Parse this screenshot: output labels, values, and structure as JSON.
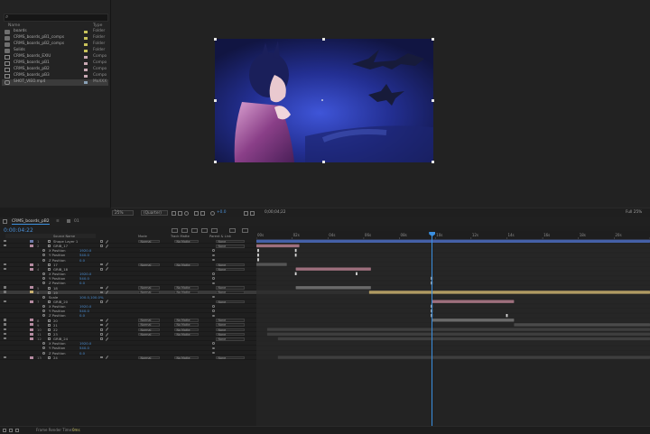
{
  "project": {
    "search_glyph": "⌕",
    "header": {
      "name": "Name",
      "type": "Type"
    },
    "items": [
      {
        "name": "boards",
        "type": "Folder",
        "kind": "folder",
        "color": "#c8c25a"
      },
      {
        "name": "CRMS_boards_pB1_comps",
        "type": "Folder",
        "kind": "folder",
        "color": "#c8c25a"
      },
      {
        "name": "CRMS_boards_pB2_comps",
        "type": "Folder",
        "kind": "folder",
        "color": "#c8c25a"
      },
      {
        "name": "Solids",
        "type": "Folder",
        "kind": "folder",
        "color": "#c8c25a"
      },
      {
        "name": "CRMS_boards_EXIU",
        "type": "Compo",
        "kind": "comp",
        "color": "#c9a9b4"
      },
      {
        "name": "CRMS_boards_pB1",
        "type": "Compo",
        "kind": "comp",
        "color": "#c9a9b4"
      },
      {
        "name": "CRMS_boards_pB2",
        "type": "Compo",
        "kind": "comp",
        "color": "#c9a9b4"
      },
      {
        "name": "CRMS_boards_pB3",
        "type": "Compo",
        "kind": "comp",
        "color": "#c9a9b4"
      },
      {
        "name": "SHOT_VIEO.mp4",
        "type": "MoXXX",
        "kind": "video",
        "color": "#8aa0b5",
        "selected": true
      }
    ]
  },
  "viewer": {
    "bpc": "8 bpc",
    "zoom": "25%",
    "resolution": "(Quarter)",
    "exposure": "+0.0",
    "timecode": "0;00;04;22",
    "channel": "Full 25%"
  },
  "timeline": {
    "tabs": [
      {
        "label": "CRMS_boards_pB2",
        "active": true
      },
      {
        "label": "01",
        "active": false
      }
    ],
    "current_time": "0:00:04:22",
    "columns": {
      "source_name": "Source Name",
      "mode": "Mode",
      "track_matte": "Track Matte",
      "parent": "Parent & Link"
    },
    "ruler": [
      "00s",
      "02s",
      "04s",
      "06s",
      "08s",
      "10s",
      "12s",
      "14s",
      "16s",
      "18s",
      "20s",
      "22s"
    ],
    "cti_seconds": 9.8,
    "layers": [
      {
        "num": "1",
        "name": "Shape Layer 1",
        "kind": "layer",
        "label": "#6c7aa8",
        "mode": "Normal",
        "matte": "No Matte",
        "parent": "None",
        "bar_start": 0.0,
        "bar_end": 22.0,
        "bar_color": "#4561a8"
      },
      {
        "num": "2",
        "name": "GRIB_17",
        "kind": "layer",
        "label": "#b48aa0",
        "mode": "",
        "matte": "",
        "parent": "None",
        "bar_start": 0.0,
        "bar_end": 2.4,
        "bar_color": "#9e6f7d"
      },
      {
        "name": "X Position",
        "value": "1920.0",
        "kind": "prop",
        "keys": [
          0.1,
          2.2
        ]
      },
      {
        "name": "Y Position",
        "value": "540.0",
        "kind": "prop",
        "keys": [
          0.1,
          2.2
        ]
      },
      {
        "name": "Z Position",
        "value": "0.0",
        "kind": "prop",
        "keys": [
          0.1
        ]
      },
      {
        "num": "3",
        "name": "17",
        "kind": "layer",
        "label": "#b48aa0",
        "mode": "Normal",
        "matte": "No Matte",
        "parent": "None",
        "bar_start": 0.0,
        "bar_end": 1.7,
        "bar_color": "#555555"
      },
      {
        "num": "4",
        "name": "GRIB_18",
        "kind": "layer",
        "label": "#b48aa0",
        "mode": "",
        "matte": "",
        "parent": "None",
        "bar_start": 2.2,
        "bar_end": 6.4,
        "bar_color": "#9e6f7d"
      },
      {
        "name": "X Position",
        "value": "1920.0",
        "kind": "prop",
        "keys": [
          2.2,
          5.6
        ]
      },
      {
        "name": "Y Position",
        "value": "540.0",
        "kind": "prop",
        "keys": [
          9.8
        ]
      },
      {
        "name": "Z Position",
        "value": "0.0",
        "kind": "prop",
        "keys": [
          9.8
        ]
      },
      {
        "num": "5",
        "name": "18",
        "kind": "layer",
        "label": "#b48aa0",
        "mode": "Normal",
        "matte": "No Matte",
        "parent": "None",
        "bar_start": 2.2,
        "bar_end": 6.4,
        "bar_color": "#6a6a6a"
      },
      {
        "num": "6",
        "name": "19",
        "kind": "layer",
        "label": "#c9b070",
        "mode": "Normal",
        "matte": "No Matte",
        "parent": "None",
        "bar_start": 6.3,
        "bar_end": 22.0,
        "bar_color": "#b09a62",
        "selected": true
      },
      {
        "name": "Scale",
        "value": "100.0,100.0%",
        "kind": "prop",
        "keys": []
      },
      {
        "num": "7",
        "name": "GRIB_20",
        "kind": "layer",
        "label": "#b48aa0",
        "mode": "",
        "matte": "",
        "parent": "None",
        "bar_start": 9.8,
        "bar_end": 14.4,
        "bar_color": "#9e6f7d"
      },
      {
        "name": "X Position",
        "value": "1920.0",
        "kind": "prop",
        "keys": [
          9.8
        ]
      },
      {
        "name": "Y Position",
        "value": "540.0",
        "kind": "prop",
        "keys": [
          9.8
        ]
      },
      {
        "name": "Z Position",
        "value": "0.0",
        "kind": "prop",
        "keys": [
          9.8,
          14.0
        ]
      },
      {
        "num": "8",
        "name": "20",
        "kind": "layer",
        "label": "#b48aa0",
        "mode": "Normal",
        "matte": "No Matte",
        "parent": "None",
        "bar_start": 9.8,
        "bar_end": 14.4,
        "bar_color": "#6a6a6a"
      },
      {
        "num": "9",
        "name": "21",
        "kind": "layer",
        "label": "#b48aa0",
        "mode": "Normal",
        "matte": "No Matte",
        "parent": "None",
        "bar_start": 14.4,
        "bar_end": 22.0,
        "bar_color": "#4a4a4a"
      },
      {
        "num": "10",
        "name": "22",
        "kind": "layer",
        "label": "#b48aa0",
        "mode": "Normal",
        "matte": "No Matte",
        "parent": "None",
        "bar_start": 0.6,
        "bar_end": 22.0,
        "bar_color": "#3e3e3e"
      },
      {
        "num": "11",
        "name": "23",
        "kind": "layer",
        "label": "#b48aa0",
        "mode": "Normal",
        "matte": "No Matte",
        "parent": "None",
        "bar_start": 0.6,
        "bar_end": 22.0,
        "bar_color": "#3e3e3e"
      },
      {
        "num": "12",
        "name": "GRIB_24",
        "kind": "layer",
        "label": "#b48aa0",
        "mode": "",
        "matte": "",
        "parent": "None",
        "bar_start": 1.2,
        "bar_end": 22.0,
        "bar_color": "#3e3e3e"
      },
      {
        "name": "X Position",
        "value": "1920.0",
        "kind": "prop",
        "keys": []
      },
      {
        "name": "Y Position",
        "value": "540.0",
        "kind": "prop",
        "keys": []
      },
      {
        "name": "Z Position",
        "value": "0.0",
        "kind": "prop",
        "keys": []
      },
      {
        "num": "13",
        "name": "24",
        "kind": "layer",
        "label": "#b48aa0",
        "mode": "Normal",
        "matte": "No Matte",
        "parent": "None",
        "bar_start": 1.2,
        "bar_end": 22.0,
        "bar_color": "#3e3e3e"
      }
    ],
    "work_area": {
      "start": 0.0,
      "end": 22.0,
      "color": "#3d8f4f"
    }
  },
  "status": {
    "label": "Frame Render Time:",
    "value": "0ms"
  },
  "colors": {
    "accent": "#3a8fe0",
    "work_area": "#3d8f4f",
    "selected_layer": "#b09a62"
  }
}
